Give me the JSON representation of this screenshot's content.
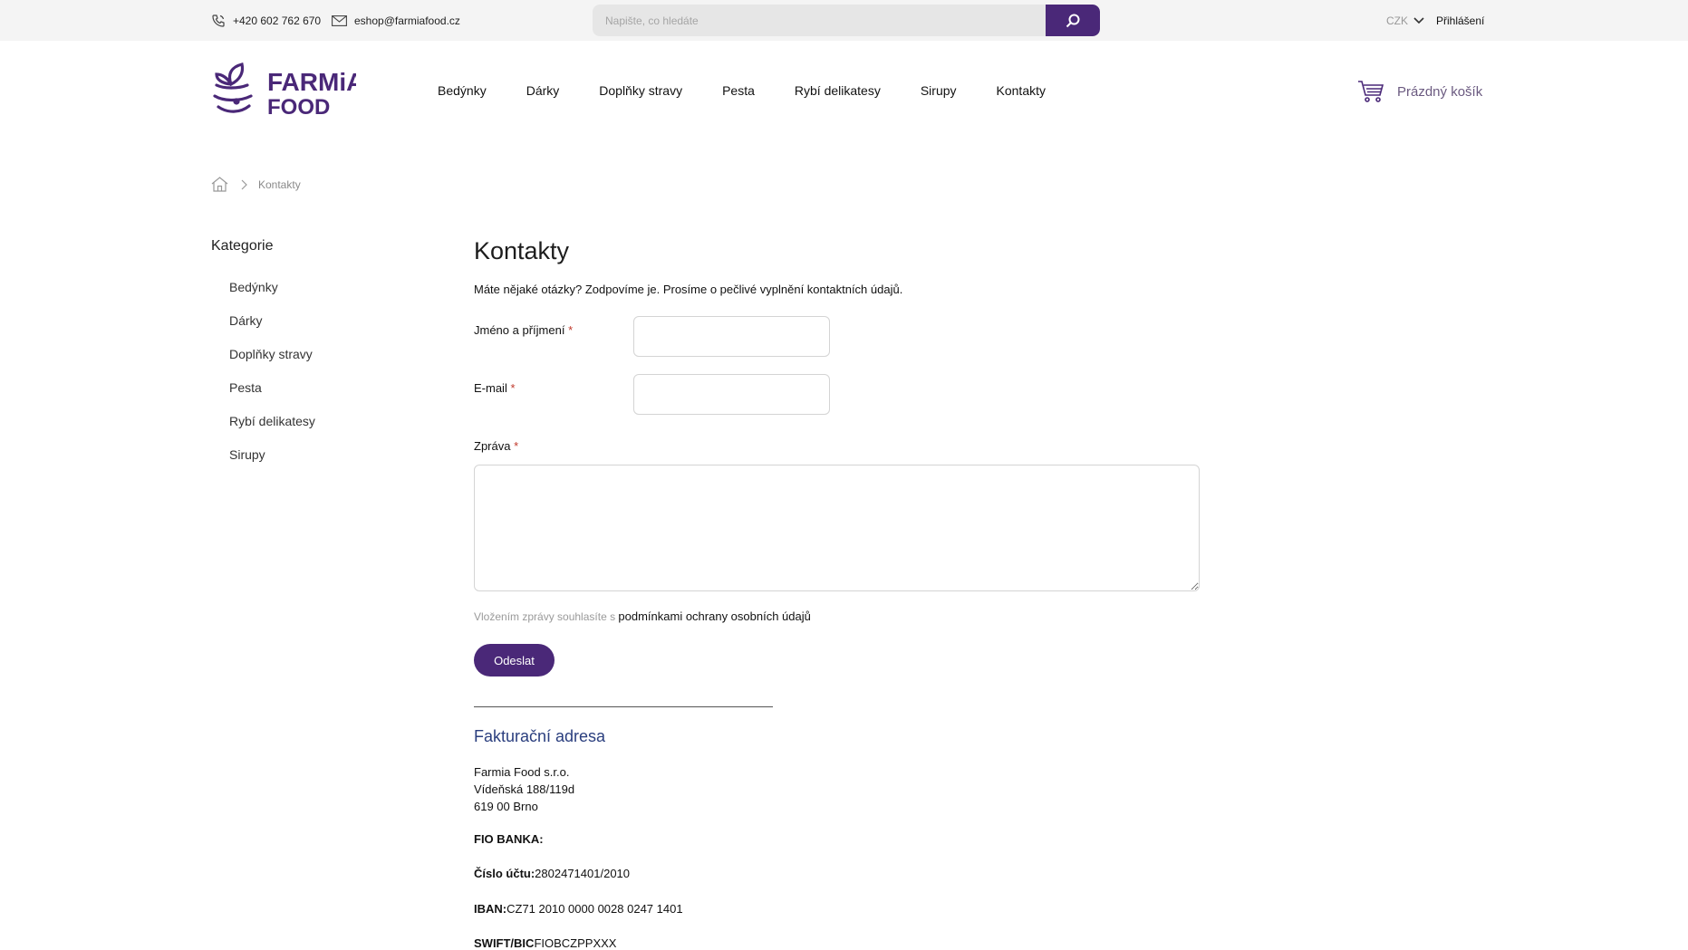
{
  "topbar": {
    "phone": "+420 602 762 670",
    "email": "eshop@farmiafood.cz",
    "search_placeholder": "Napište, co hledáte",
    "currency": "CZK",
    "login": "Přihlášení"
  },
  "header": {
    "logo_text_top": "FARMiA",
    "logo_text_bottom": "FOOD",
    "nav": [
      "Bedýnky",
      "Dárky",
      "Doplňky stravy",
      "Pesta",
      "Rybí delikatesy",
      "Sirupy",
      "Kontakty"
    ],
    "cart": "Prázdný košík"
  },
  "breadcrumb": {
    "current": "Kontakty"
  },
  "sidebar": {
    "title": "Kategorie",
    "items": [
      "Bedýnky",
      "Dárky",
      "Doplňky stravy",
      "Pesta",
      "Rybí delikatesy",
      "Sirupy"
    ]
  },
  "main": {
    "title": "Kontakty",
    "intro": "Máte nějaké otázky? Zodpovíme je. Prosíme o pečlivé vyplnění kontaktních údajů.",
    "form": {
      "name_label": "Jméno a příjmení",
      "email_label": "E-mail",
      "message_label": "Zpráva",
      "required_mark": "*",
      "consent_text": "Vložením zprávy souhlasíte s ",
      "consent_link": "podmínkami ochrany osobních údajů",
      "submit": "Odeslat"
    },
    "billing": {
      "title": "Fakturační adresa",
      "company": "Farmia Food s.r.o.",
      "street": "Vídeňská 188/119d",
      "city": "619 00 Brno",
      "bank_name": "FIO BANKA:",
      "account_label": "Číslo účtu:",
      "account_value": "2802471401/2010",
      "iban_label": "IBAN:",
      "iban_value": "CZ71 2010 0000 0028 0247 1401",
      "swift_label": "SWIFT/BIC",
      "swift_value": "FIOBCZPPXXX"
    }
  },
  "colors": {
    "brand": "#4a2878",
    "billing_title": "#2a3e7e",
    "required": "#c0392b"
  }
}
